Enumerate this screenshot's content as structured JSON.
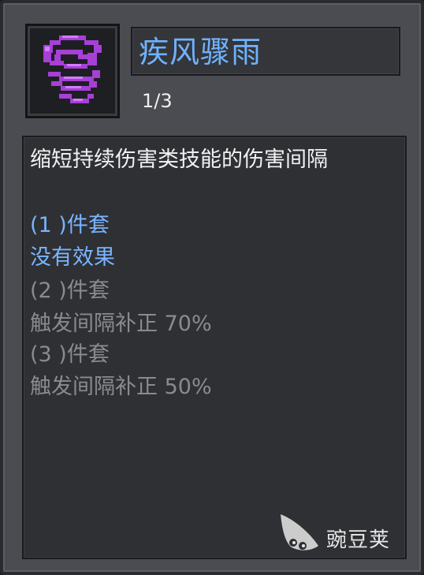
{
  "skill": {
    "name": "疾风骤雨",
    "level": "1/3",
    "icon": "tornado-icon",
    "icon_color": "#b24ee6"
  },
  "description": {
    "text": "缩短持续伤害类技能的伤害间隔",
    "sets": [
      {
        "label": "(1 )件套",
        "effect": "没有效果",
        "active": true
      },
      {
        "label": "(2 )件套",
        "effect": "触发间隔补正 70%",
        "active": false
      },
      {
        "label": "(3 )件套",
        "effect": "触发间隔补正 50%",
        "active": false
      }
    ]
  },
  "watermark": {
    "text": "豌豆荚"
  },
  "colors": {
    "title": "#6fb2ff",
    "active_set": "#7ab4ff",
    "inactive_set": "#8a8b8e",
    "text": "#f2f2f2"
  }
}
